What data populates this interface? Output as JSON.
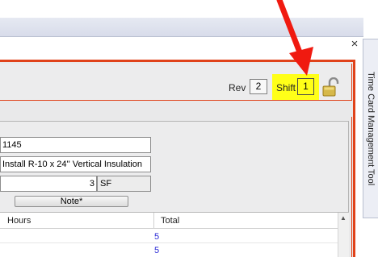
{
  "side_tab": {
    "label": "Time Card Management Tool"
  },
  "window": {
    "close_glyph": "×"
  },
  "header": {
    "rev_label": "Rev",
    "rev_value": "2",
    "shift_label": "Shift",
    "shift_value": "1",
    "lock_icon": "padlock-open-icon",
    "highlight_color": "#ffff18",
    "accent_color": "#e0421a"
  },
  "form": {
    "code_value": "1145",
    "description_value": "Install R-10 x 24'' Vertical Insulation",
    "quantity_value": "3",
    "unit_value": "SF",
    "note_button_label": "Note*"
  },
  "grid": {
    "columns": [
      "Hours",
      "Total"
    ],
    "rows": [
      {
        "hours": "",
        "total": "5"
      },
      {
        "hours": "",
        "total": "5"
      }
    ]
  }
}
